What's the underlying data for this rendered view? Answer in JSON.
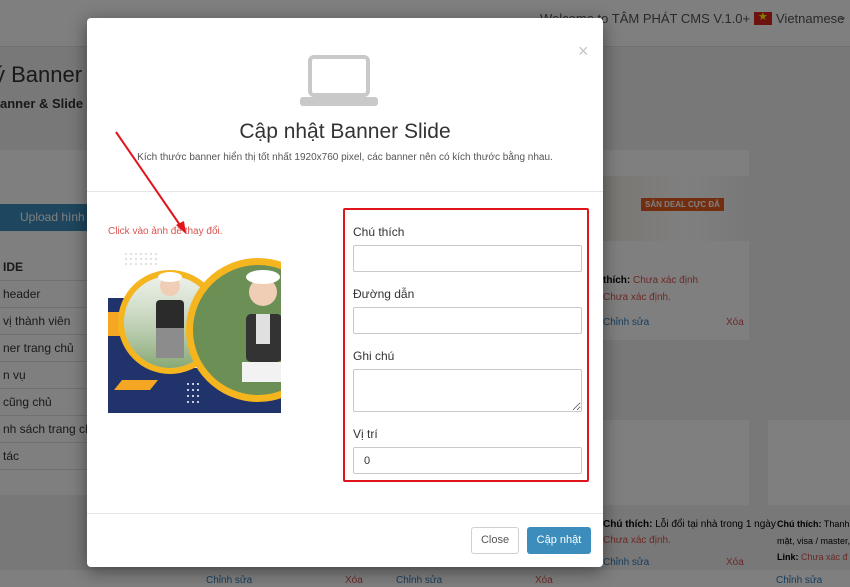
{
  "header": {
    "welcome": "Welcome to TÂM PHÁT CMS V.1.0+",
    "language": "Vietnamese"
  },
  "page": {
    "title": "ý Banner &",
    "breadcrumb": "anner & Slide",
    "upload_button": "Upload hình ả",
    "sidebar_items": [
      "IDE",
      " header",
      " vị thành viên",
      "ner trang chủ",
      "n vụ",
      " cũng chủ",
      "nh sách trang chủ",
      "tác"
    ]
  },
  "cards": {
    "right_tag": "SĂN DEAL CỰC ĐÃ",
    "right_note_label": "thích:",
    "right_note_value": "Chưa xác định",
    "right_link_value": "Chưa xác định.",
    "edit": "Chỉnh sửa",
    "delete": "Xóa",
    "b1_note_label": "Chú thích:",
    "b1_note_value": "Lỗi đổi tại nhà trong 1 ngày",
    "b1_link_value": "Chưa xác định.",
    "b2_note_label": "Chú thích:",
    "b2_note_value": "Thanh t",
    "b2_note_line2": "mặt, visa / master,",
    "b2_link_label": "Link:",
    "b2_link_value": "Chưa xác đ"
  },
  "modal": {
    "title": "Cập nhật Banner Slide",
    "subtitle": "Kích thước banner hiển thị tốt nhất 1920x760 pixel, các banner nên có kích thước bằng nhau.",
    "close_glyph": "×",
    "hint": "Click vào ảnh để thay đổi.",
    "fields": {
      "caption_label": "Chú thích",
      "caption_value": "",
      "link_label": "Đường dẫn",
      "link_value": "",
      "note_label": "Ghi chú",
      "note_value": "",
      "position_label": "Vị trí",
      "position_value": "0"
    },
    "close_button": "Close",
    "save_button": "Cập nhật"
  },
  "colors": {
    "accent": "#3c8dbc",
    "highlight_border": "#e0141b",
    "error_text": "#d9534f"
  },
  "icons": [
    "laptop-icon",
    "close-icon",
    "flag-icon",
    "chevron-down-icon"
  ]
}
